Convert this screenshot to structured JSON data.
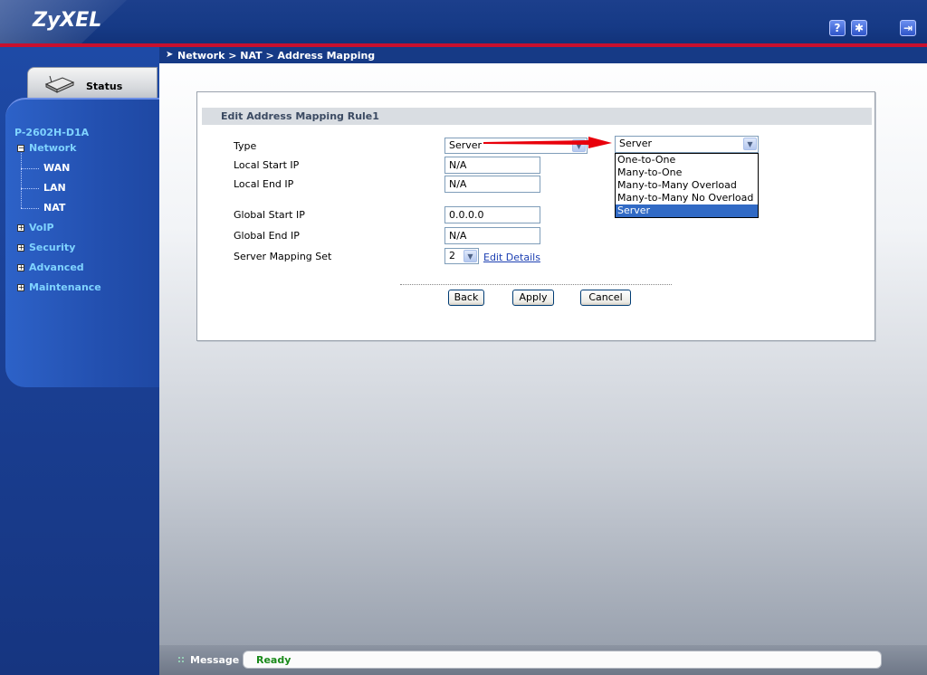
{
  "header": {
    "logo": "ZyXEL",
    "help_icon_glyph": "?",
    "wizard_icon_glyph": "✱",
    "logout_icon_glyph": "⇥"
  },
  "sidebar": {
    "status_tab": "Status",
    "device_name": "P-2602H-D1A",
    "menu": [
      {
        "label": "Network",
        "expanded": true,
        "sub": [
          "WAN",
          "LAN",
          "NAT"
        ]
      },
      {
        "label": "VoIP",
        "expanded": false
      },
      {
        "label": "Security",
        "expanded": false
      },
      {
        "label": "Advanced",
        "expanded": false
      },
      {
        "label": "Maintenance",
        "expanded": false
      }
    ]
  },
  "breadcrumb": "Network > NAT > Address Mapping",
  "panel": {
    "title": "Edit Address Mapping Rule1",
    "fields": {
      "type_label": "Type",
      "type_value": "Server",
      "local_start_label": "Local Start IP",
      "local_start_value": "N/A",
      "local_end_label": "Local End IP",
      "local_end_value": "N/A",
      "global_start_label": "Global Start IP",
      "global_start_value": "0.0.0.0",
      "global_end_label": "Global End IP",
      "global_end_value": "N/A",
      "server_set_label": "Server Mapping Set",
      "server_set_value": "2",
      "edit_details": "Edit Details"
    },
    "type_dropdown": {
      "selected": "Server",
      "options": [
        "One-to-One",
        "Many-to-One",
        "Many-to-Many Overload",
        "Many-to-Many No Overload",
        "Server"
      ]
    },
    "buttons": {
      "back": "Back",
      "apply": "Apply",
      "cancel": "Cancel"
    }
  },
  "statusbar": {
    "label": "Message",
    "text": "Ready"
  },
  "colors": {
    "header_bg": "#163a86",
    "header_stripe": "#c8102e",
    "menu_text": "#7fd3ff",
    "selected_option": "#316ac5",
    "status_ok": "#1a8a1a",
    "annotation_arrow": "#e8000b"
  }
}
